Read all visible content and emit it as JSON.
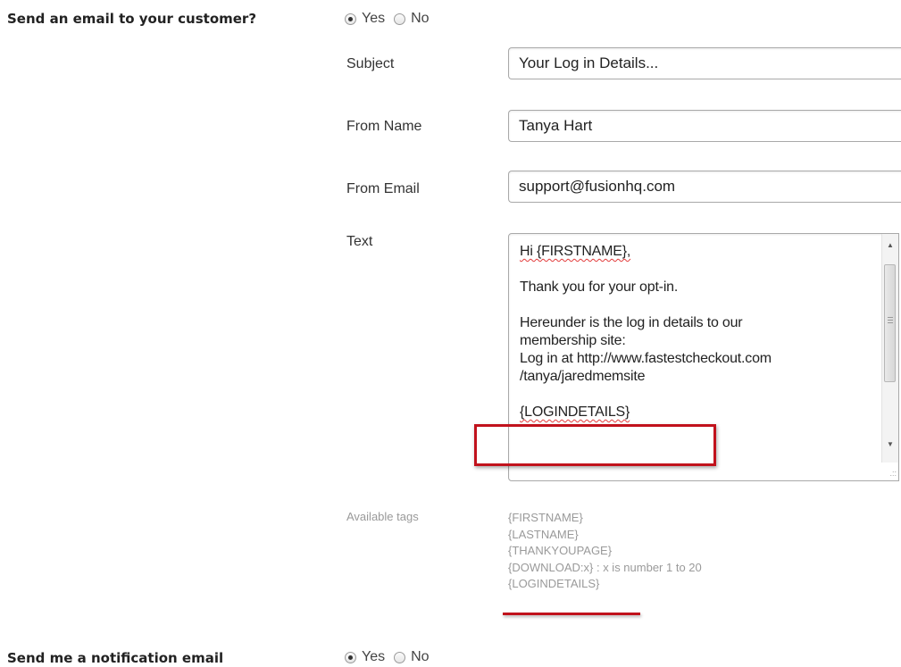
{
  "customer_email": {
    "question": "Send an email to your customer?",
    "options": [
      {
        "label": "Yes",
        "checked": true
      },
      {
        "label": "No",
        "checked": false
      }
    ]
  },
  "fields": {
    "subject": {
      "label": "Subject",
      "value": "Your Log in Details..."
    },
    "from_name": {
      "label": "From Name",
      "value": "Tanya Hart"
    },
    "from_email": {
      "label": "From Email",
      "value": "support@fusionhq.com"
    },
    "text": {
      "label": "Text",
      "lines": [
        "Hi {FIRSTNAME},",
        "",
        "Thank you for your opt-in.",
        "",
        "Hereunder is the log in details to our",
        "membership site:",
        "Log in at http://www.fastestcheckout.com",
        "/tanya/jaredmemsite",
        "",
        "{LOGINDETAILS}"
      ]
    }
  },
  "available_tags": {
    "label": "Available tags",
    "items": [
      "{FIRSTNAME}",
      "{LASTNAME}",
      "{THANKYOUPAGE}",
      "{DOWNLOAD:x} : x is number 1 to 20",
      "{LOGINDETAILS}"
    ]
  },
  "notification_email": {
    "question": "Send me a notification email",
    "options": [
      {
        "label": "Yes",
        "checked": true
      },
      {
        "label": "No",
        "checked": false
      }
    ]
  },
  "icons": {
    "scroll_up": "triangle-up",
    "scroll_down": "triangle-down",
    "resize": "resize-grip"
  },
  "colors": {
    "highlight": "#c1121c",
    "muted_text": "#9a9a9a"
  }
}
